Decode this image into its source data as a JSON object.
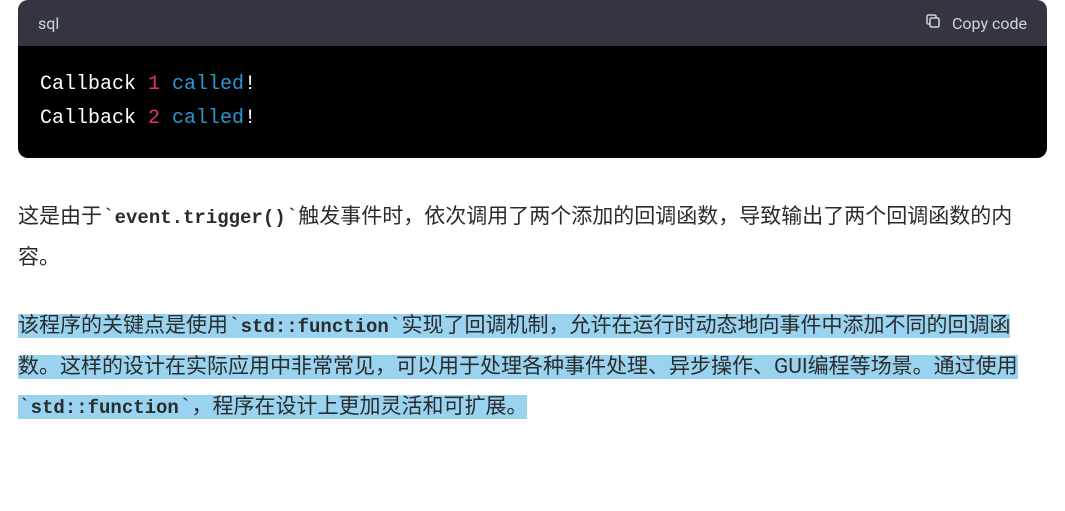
{
  "code_block": {
    "language": "sql",
    "copy_label": "Copy code",
    "lines": [
      {
        "prefix": "Callback ",
        "num": "1",
        "kw": " called",
        "suffix": "!"
      },
      {
        "prefix": "Callback ",
        "num": "2",
        "kw": " called",
        "suffix": "!"
      }
    ]
  },
  "para1": {
    "t1": "这是由于",
    "code1": "event.trigger()",
    "t2": "触发事件时，依次调用了两个添加的回调函数，导致输出了两个回调函数的内容。"
  },
  "para2": {
    "t1": "该程序的关键点是使用",
    "code1": "std::function",
    "t2": "实现了回调机制，允许在运行时动态地向事件中添加不同的回调函数。这样的设计在实际应用中非常常见，可以用于处理各种事件处理、异步操作、GUI编程等场景。通过使用",
    "code2": "std::function",
    "t3": "，程序在设计上更加灵活和可扩展。"
  },
  "backtick": "`"
}
